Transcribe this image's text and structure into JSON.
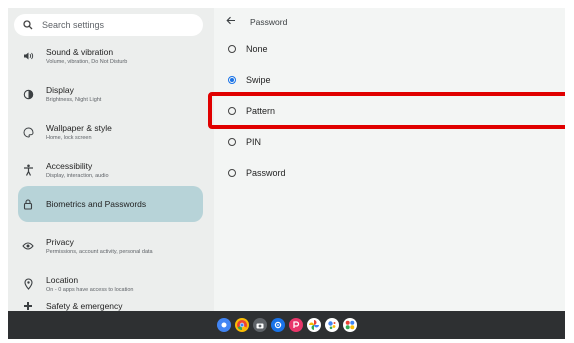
{
  "search": {
    "placeholder": "Search settings"
  },
  "sidebar": {
    "items": [
      {
        "title": "Sound & vibration",
        "subtitle": "Volume, vibration, Do Not Disturb",
        "icon": "speaker-icon"
      },
      {
        "title": "Display",
        "subtitle": "Brightness, Night Light",
        "icon": "brightness-icon"
      },
      {
        "title": "Wallpaper & style",
        "subtitle": "Home, lock screen",
        "icon": "palette-icon"
      },
      {
        "title": "Accessibility",
        "subtitle": "Display, interaction, audio",
        "icon": "accessibility-icon"
      },
      {
        "title": "Biometrics and Passwords",
        "subtitle": "",
        "icon": "lock-icon",
        "selected": true
      },
      {
        "title": "Privacy",
        "subtitle": "Permissions, account activity, personal data",
        "icon": "privacy-icon"
      },
      {
        "title": "Location",
        "subtitle": "On - 0 apps have access to location",
        "icon": "location-icon"
      },
      {
        "title": "Safety & emergency",
        "subtitle": "",
        "icon": "emergency-icon"
      }
    ]
  },
  "header": {
    "title": "Password"
  },
  "options": [
    {
      "label": "None",
      "selected": false
    },
    {
      "label": "Swipe",
      "selected": true
    },
    {
      "label": "Pattern",
      "selected": false,
      "highlighted": true
    },
    {
      "label": "PIN",
      "selected": false
    },
    {
      "label": "Password",
      "selected": false
    }
  ],
  "colors": {
    "accent": "#1a73e8",
    "highlight": "#e00000",
    "selected_bg": "#b7d3d8",
    "taskbar": "#2e3032"
  },
  "taskbar": {
    "apps": [
      {
        "name": "launcher-icon",
        "color": "#4285f4"
      },
      {
        "name": "chrome-icon",
        "color": "#fbbc05"
      },
      {
        "name": "camera-icon",
        "color": "#5f6368"
      },
      {
        "name": "settings-icon",
        "color": "#1a73e8"
      },
      {
        "name": "app-p-icon",
        "color": "#e8366a"
      },
      {
        "name": "photos-icon",
        "color": "#f4b400"
      },
      {
        "name": "assistant-icon",
        "color": "#4285f4"
      },
      {
        "name": "app-grid-icon",
        "color": "#ea4335"
      }
    ]
  }
}
